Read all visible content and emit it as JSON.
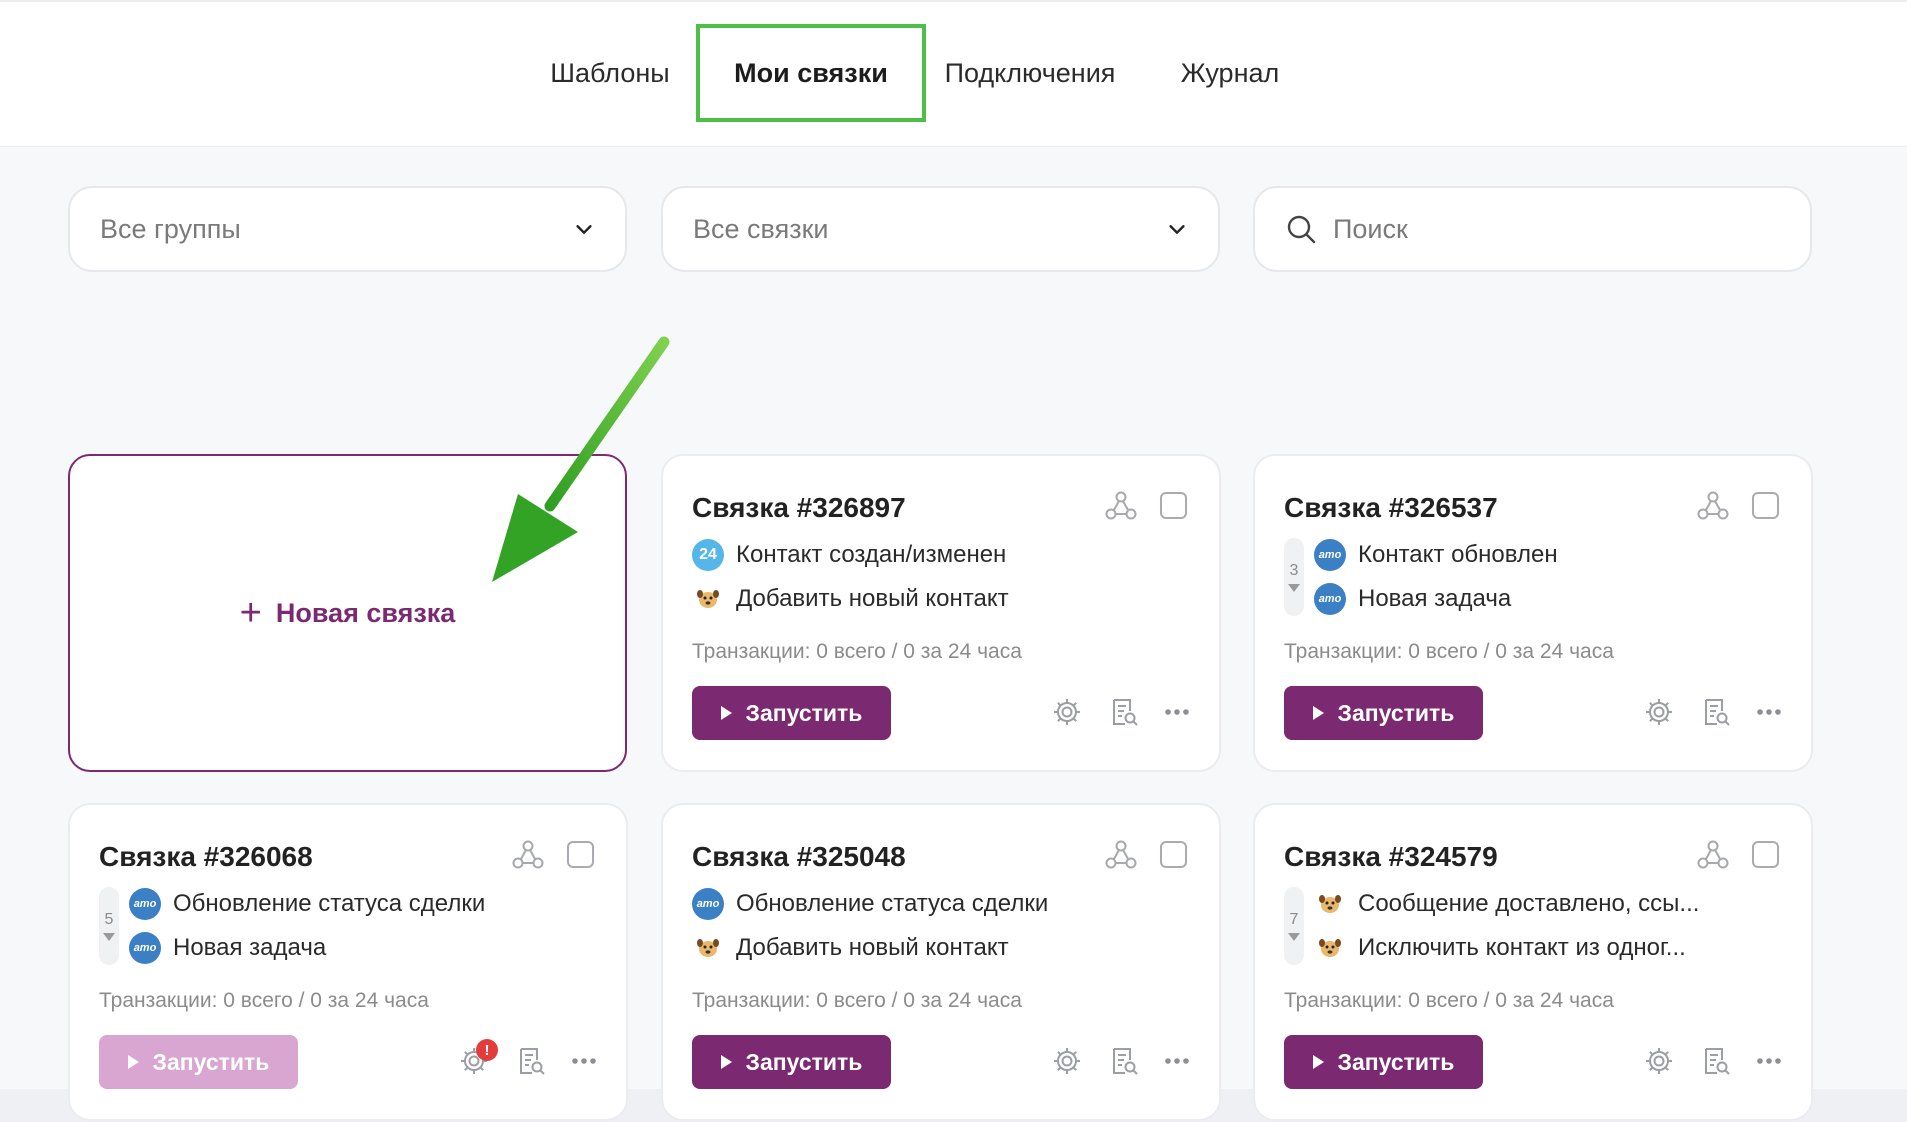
{
  "tabs": [
    {
      "label": "Шаблоны",
      "active": false
    },
    {
      "label": "Мои связки",
      "active": true
    },
    {
      "label": "Подключения",
      "active": false
    },
    {
      "label": "Журнал",
      "active": false
    }
  ],
  "filters": {
    "groups": {
      "value": "Все группы"
    },
    "links": {
      "value": "Все связки"
    },
    "search": {
      "placeholder": "Поиск",
      "value": ""
    }
  },
  "new_card": {
    "label": "Новая связка"
  },
  "cards": [
    {
      "title": "Связка #326897",
      "steps": [
        {
          "badge": "24",
          "badge_type": "num",
          "text": "Контакт создан/изменен"
        },
        {
          "badge": "bot",
          "badge_type": "bot",
          "text": "Добавить новый контакт"
        }
      ],
      "transactions": "Транзакции: 0 всего / 0 за 24 часа",
      "run_label": "Запустить"
    },
    {
      "title": "Связка #326537",
      "counter": "3",
      "steps": [
        {
          "badge": "amo",
          "badge_type": "amo",
          "text": "Контакт обновлен"
        },
        {
          "badge": "amo",
          "badge_type": "amo",
          "text": "Новая задача"
        }
      ],
      "transactions": "Транзакции: 0 всего / 0 за 24 часа",
      "run_label": "Запустить"
    },
    {
      "title": "Связка #326068",
      "counter": "5",
      "steps": [
        {
          "badge": "amo",
          "badge_type": "amo",
          "text": "Обновление статуса сделки"
        },
        {
          "badge": "amo",
          "badge_type": "amo",
          "text": "Новая задача"
        }
      ],
      "transactions": "Транзакции: 0 всего / 0 за 24 часа",
      "run_label": "Запустить",
      "alert": "!"
    },
    {
      "title": "Связка #325048",
      "steps": [
        {
          "badge": "amo",
          "badge_type": "amo",
          "text": "Обновление статуса сделки"
        },
        {
          "badge": "bot",
          "badge_type": "bot",
          "text": "Добавить новый контакт"
        }
      ],
      "transactions": "Транзакции: 0 всего / 0 за 24 часа",
      "run_label": "Запустить"
    },
    {
      "title": "Связка #324579",
      "counter": "7",
      "steps": [
        {
          "badge": "bot",
          "badge_type": "bot",
          "text": "Сообщение доставлено, ссы..."
        },
        {
          "badge": "bot",
          "badge_type": "bot",
          "text": "Исключить контакт из одног..."
        }
      ],
      "transactions": "Транзакции: 0 всего / 0 за 24 часа",
      "run_label": "Запустить"
    }
  ],
  "badge_labels": {
    "amo": "amo"
  },
  "colors": {
    "accent": "#7b2a72",
    "accent_disabled": "#d8a6d0",
    "active_tab_border": "#4dbf47",
    "amo_badge": "#3b7fc4",
    "count_badge": "#55b6ea",
    "alert": "#e43c3c",
    "arrow": "#45b52e"
  }
}
